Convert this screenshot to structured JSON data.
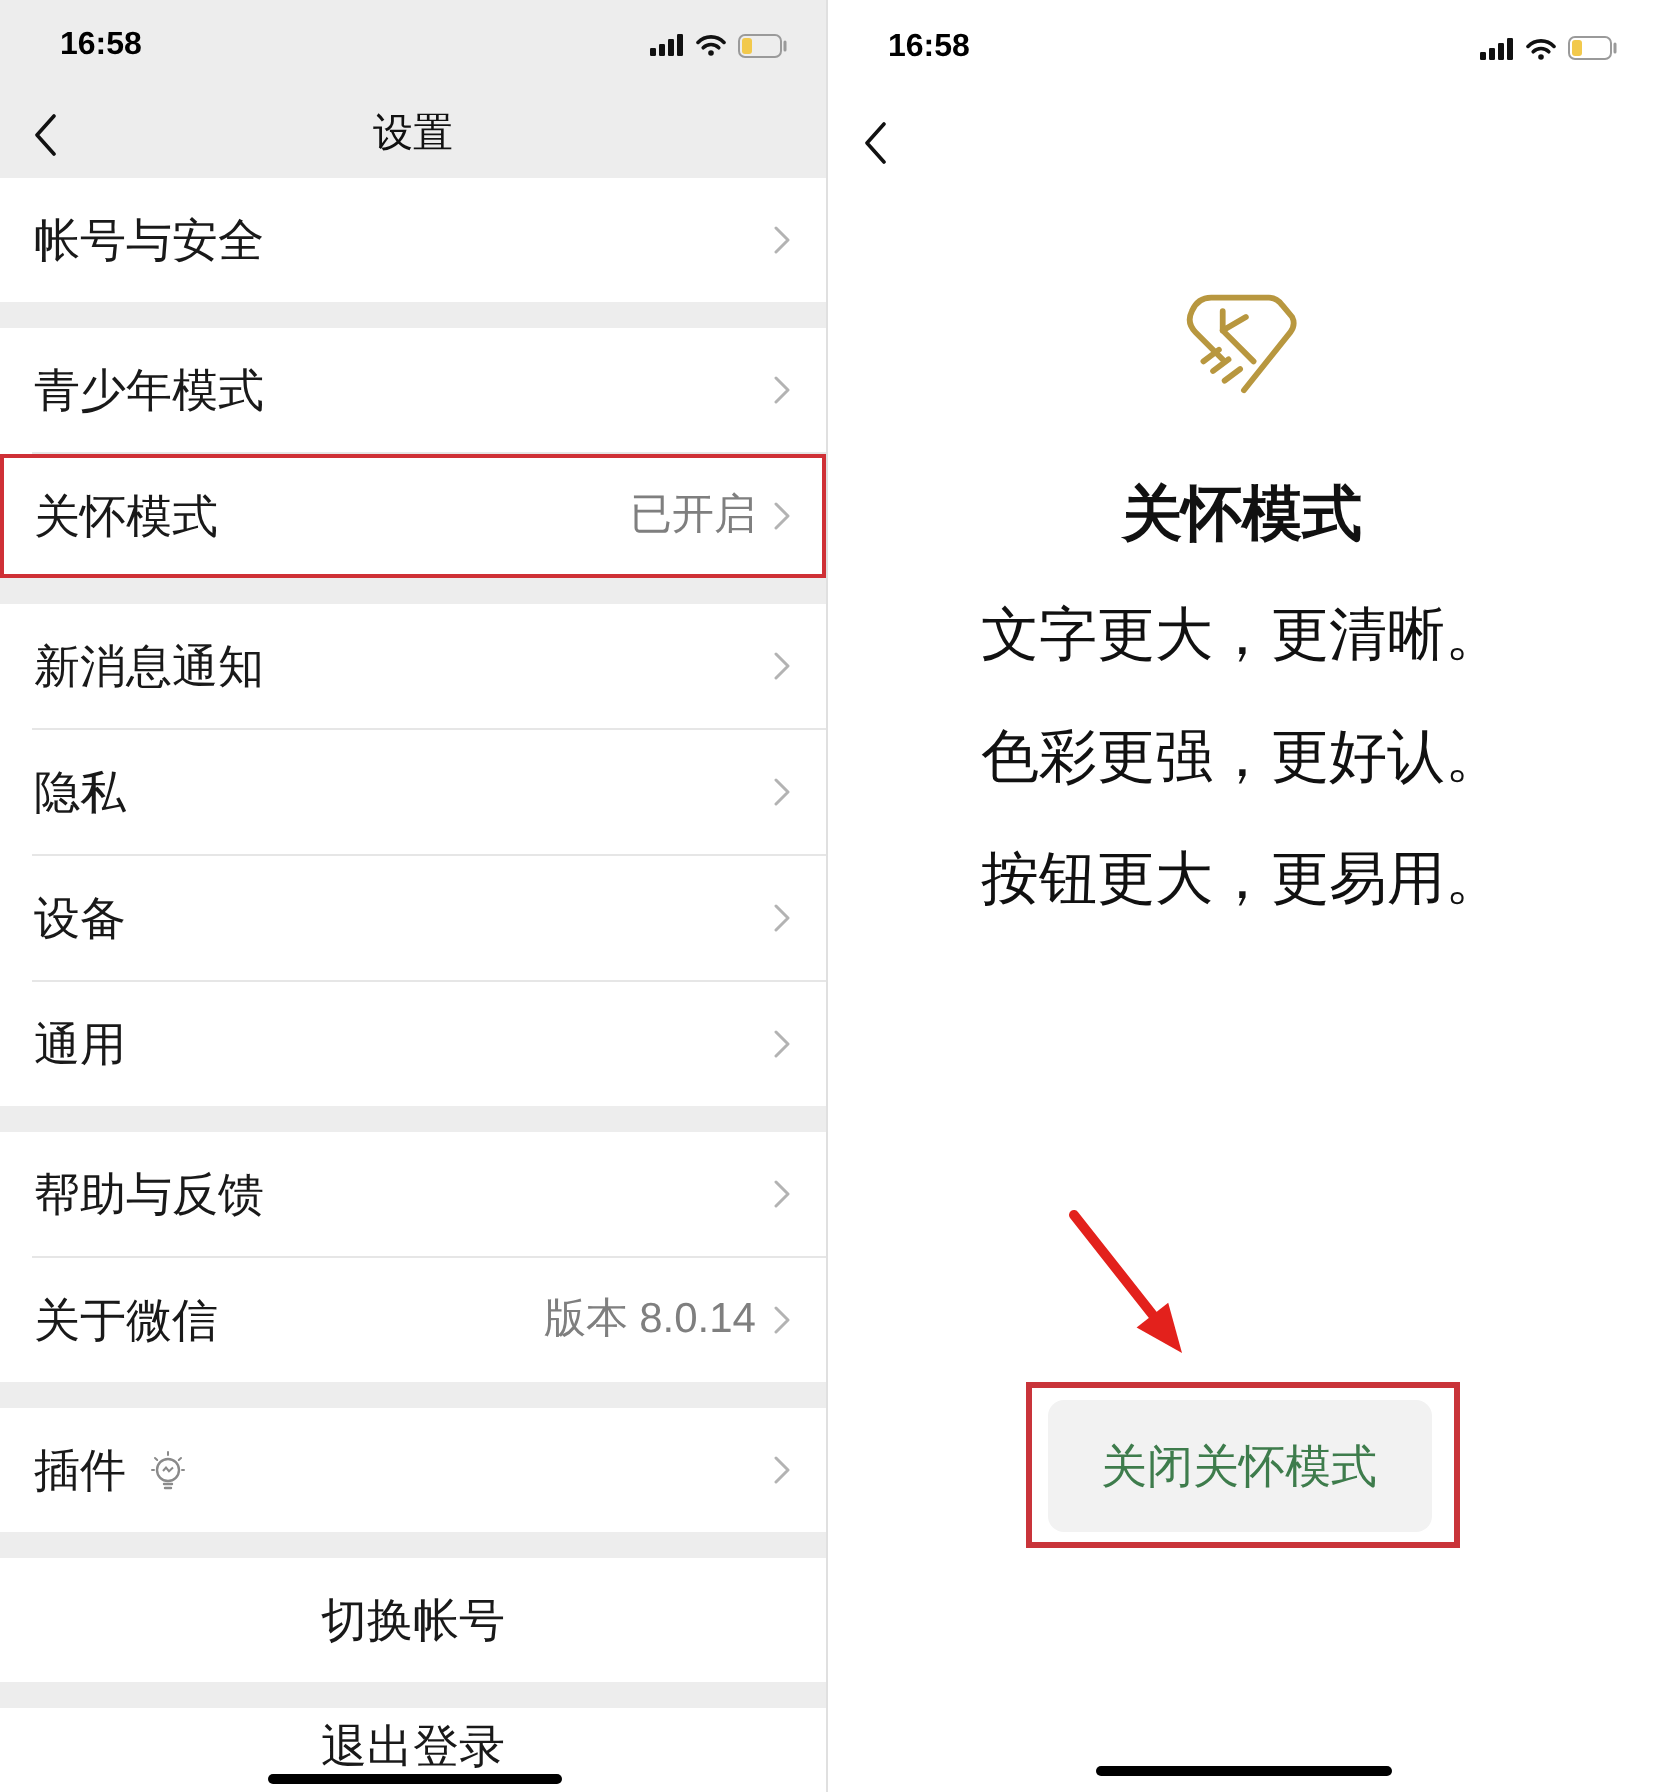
{
  "left_screen": {
    "status_bar": {
      "time": "16:58"
    },
    "title": "设置",
    "groups": [
      {
        "rows": [
          {
            "kind": "link",
            "label": "帐号与安全",
            "highlighted": false
          }
        ]
      },
      {
        "rows": [
          {
            "kind": "link",
            "label": "青少年模式",
            "highlighted": false
          },
          {
            "kind": "link",
            "label": "关怀模式",
            "value": "已开启",
            "highlighted": true
          }
        ]
      },
      {
        "rows": [
          {
            "kind": "link",
            "label": "新消息通知",
            "highlighted": false
          },
          {
            "kind": "link",
            "label": "隐私",
            "highlighted": false
          },
          {
            "kind": "link",
            "label": "设备",
            "highlighted": false
          },
          {
            "kind": "link",
            "label": "通用",
            "highlighted": false
          }
        ]
      },
      {
        "rows": [
          {
            "kind": "link",
            "label": "帮助与反馈",
            "highlighted": false
          },
          {
            "kind": "link",
            "label": "关于微信",
            "value": "版本 8.0.14",
            "highlighted": false
          }
        ]
      },
      {
        "rows": [
          {
            "kind": "link_icon",
            "label": "插件",
            "highlighted": false
          }
        ]
      },
      {
        "rows": [
          {
            "kind": "action",
            "label": "切换帐号",
            "highlighted": false
          }
        ]
      },
      {
        "rows": [
          {
            "kind": "action",
            "label": "退出登录",
            "highlighted": false
          }
        ]
      }
    ]
  },
  "right_screen": {
    "status_bar": {
      "time": "16:58"
    },
    "title": "关怀模式",
    "lines": [
      "文字更大，更清晰。",
      "色彩更强，更好认。",
      "按钮更大，更易用。"
    ],
    "button": {
      "label": "关闭关怀模式",
      "highlighted": true
    }
  }
}
